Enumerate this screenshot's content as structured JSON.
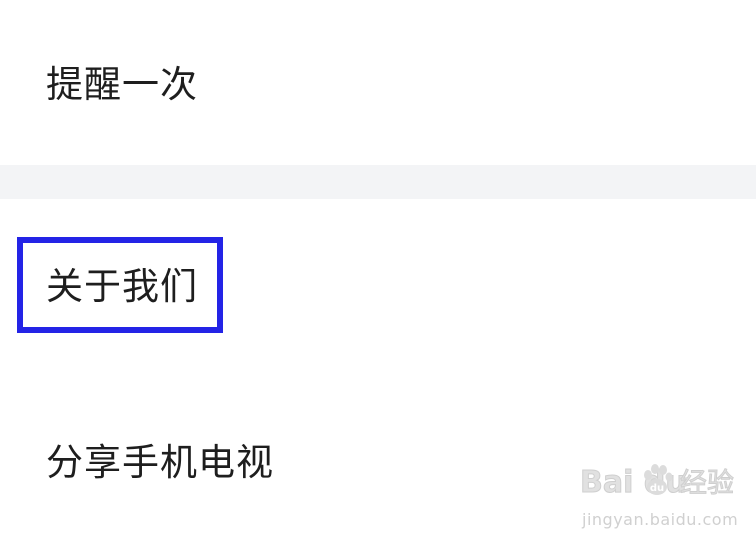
{
  "settings_menu": {
    "items": [
      {
        "label": "提醒一次"
      },
      {
        "label": "关于我们",
        "highlighted": true
      },
      {
        "label": "分享手机电视"
      }
    ],
    "colors": {
      "background": "#ffffff",
      "section_divider": "#f3f4f6",
      "text": "#1e1e1e",
      "highlight_border": "#2323e6"
    }
  },
  "watermark": {
    "brand": "Bai du",
    "suffix": "经验",
    "url": "jingyan.baidu.com",
    "icon": "baidu-paw-icon"
  }
}
